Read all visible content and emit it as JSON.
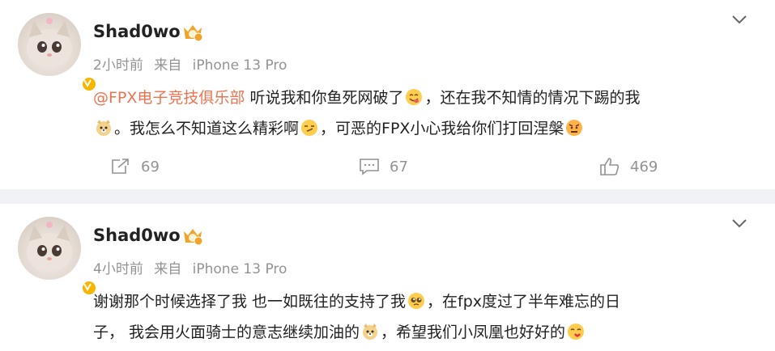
{
  "posts": [
    {
      "username": "Shad0wo",
      "time": "2小时前",
      "source_prefix": "来自",
      "device": "iPhone 13 Pro",
      "mention": "@FPX电子竞技俱乐部",
      "line1_text": " 听说我和你鱼死网破了",
      "line1_after_emoji": "，还在我不知情的情况下踢的我",
      "line2_text": "。我怎么不知道这么精彩啊",
      "line2_after_emoji": "，可恶的FPX小心我给你们打回涅槃",
      "actions": {
        "repost": "69",
        "comment": "67",
        "like": "469"
      },
      "icons": [
        "avatar-cat",
        "verified-icon",
        "vip-badge-icon",
        "chevron-down-icon",
        "yum-emoji-icon",
        "doge-emoji-icon",
        "smirk-emoji-icon",
        "angry-emoji-icon",
        "repost-icon",
        "comment-icon",
        "like-icon"
      ]
    },
    {
      "username": "Shad0wo",
      "time": "4小时前",
      "source_prefix": "来自",
      "device": "iPhone 13 Pro",
      "line1_text": "谢谢那个时候选择了我 也一如既往的支持了我",
      "line1_after_emoji": "，在fpx度过了半年难忘的日",
      "line2_text": "子， 我会用火面骑士的意志继续加油的",
      "line2_after_emoji": "，希望我们小凤凰也好好的",
      "icons": [
        "avatar-cat",
        "verified-icon",
        "vip-badge-icon",
        "chevron-down-icon",
        "pleading-emoji-icon",
        "doge-emoji-icon",
        "kiss-emoji-icon"
      ]
    }
  ],
  "colors": {
    "mention": "#eb7350",
    "meta": "#939393",
    "verified": "#f7b500",
    "separator": "#f1f2f5"
  }
}
